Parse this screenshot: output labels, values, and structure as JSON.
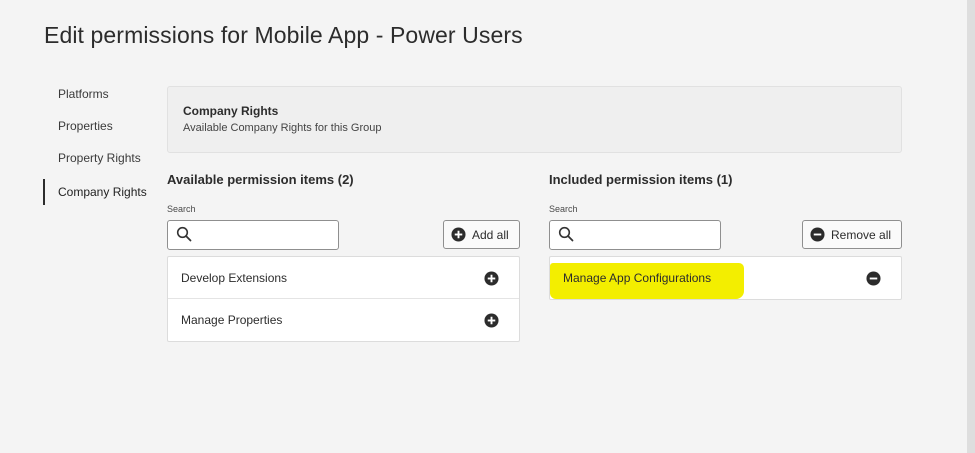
{
  "page": {
    "title": "Edit permissions for Mobile App - Power Users"
  },
  "sidebar": {
    "items": [
      {
        "label": "Platforms",
        "active": false
      },
      {
        "label": "Properties",
        "active": false
      },
      {
        "label": "Property Rights",
        "active": false
      },
      {
        "label": "Company Rights",
        "active": true
      }
    ]
  },
  "info": {
    "title": "Company Rights",
    "subtitle": "Available Company Rights for this Group"
  },
  "available": {
    "heading": "Available permission items (2)",
    "search_label": "Search",
    "search_value": "",
    "add_all_label": "Add all",
    "items": [
      {
        "label": "Develop Extensions",
        "icon": "plus-circle-icon"
      },
      {
        "label": "Manage Properties",
        "icon": "plus-circle-icon"
      }
    ]
  },
  "included": {
    "heading": "Included permission items (1)",
    "search_label": "Search",
    "search_value": "",
    "remove_all_label": "Remove all",
    "items": [
      {
        "label": "Manage App Configurations",
        "icon": "minus-circle-icon",
        "highlighted": true
      }
    ]
  },
  "colors": {
    "background": "#f4f4f4",
    "highlight": "#f3ee00",
    "text": "#2c2c2c",
    "border": "#8f8f8f"
  }
}
